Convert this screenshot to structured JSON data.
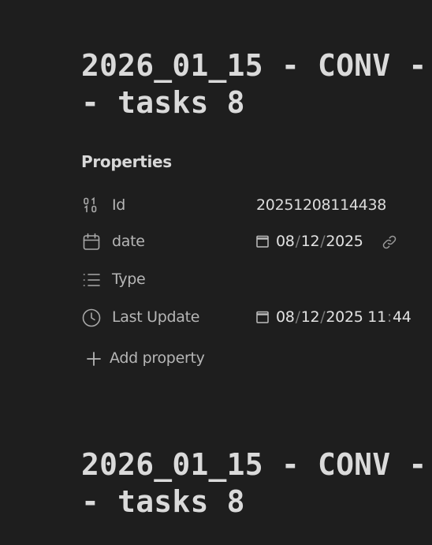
{
  "note": {
    "title_line1": "2026_01_15 - CONV -",
    "title_line2": "- tasks 8"
  },
  "properties": {
    "heading": "Properties",
    "rows": [
      {
        "icon": "binary-icon",
        "label": "Id",
        "value": "20251208114438"
      },
      {
        "icon": "calendar-icon",
        "label": "date",
        "date": {
          "d": "08",
          "m": "12",
          "y": "2025"
        }
      },
      {
        "icon": "list-icon",
        "label": "Type",
        "value": ""
      },
      {
        "icon": "clock-icon",
        "label": "Last Update",
        "date": {
          "d": "08",
          "m": "12",
          "y": "2025",
          "h": "11",
          "min": "44"
        }
      }
    ],
    "add_label": "Add property"
  },
  "colors": {
    "background": "#1e1e1e",
    "text": "#dcddde",
    "muted": "#b6b6b6",
    "separator": "#7a7a7a"
  }
}
